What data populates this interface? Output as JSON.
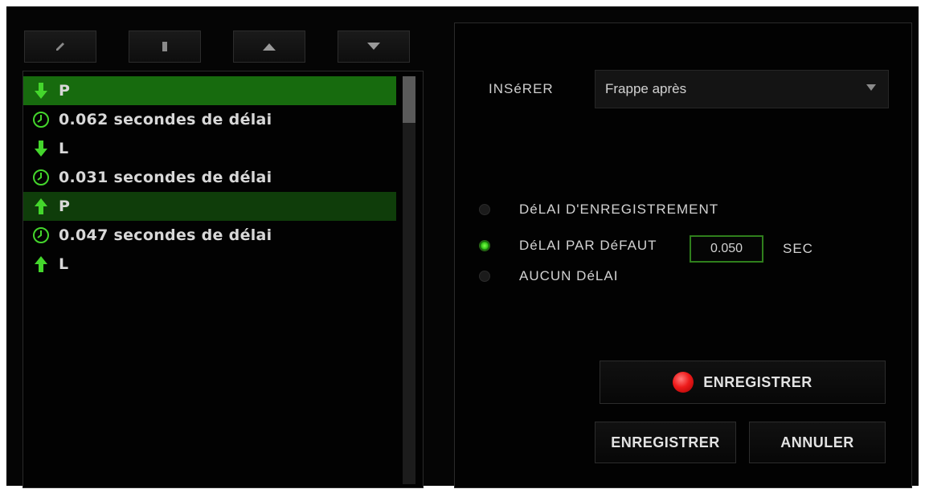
{
  "toolbar": {
    "buttons": [
      {
        "name": "edit-button",
        "icon": "pencil-icon"
      },
      {
        "name": "delete-button",
        "icon": "trash-icon"
      },
      {
        "name": "move-up-button",
        "icon": "triangle-up-icon"
      },
      {
        "name": "move-down-button",
        "icon": "triangle-down-icon"
      }
    ]
  },
  "macro_list": {
    "items": [
      {
        "type": "key-down",
        "label": "P",
        "selected": true
      },
      {
        "type": "delay",
        "label": "0.062 secondes de délai"
      },
      {
        "type": "key-down",
        "label": "L"
      },
      {
        "type": "delay",
        "label": "0.031 secondes de délai"
      },
      {
        "type": "key-up",
        "label": "P",
        "selected": true
      },
      {
        "type": "delay",
        "label": "0.047 secondes de délai"
      },
      {
        "type": "key-up",
        "label": "L"
      }
    ]
  },
  "insert": {
    "label": "INSéRER",
    "selected": "Frappe après"
  },
  "delay_options": {
    "record": "DéLAI D'ENREGISTREMENT",
    "default": "DéLAI PAR DéFAUT",
    "default_value": "0.050",
    "unit": "SEC",
    "none": "AUCUN DéLAI",
    "selected": "default"
  },
  "buttons": {
    "record": "ENREGISTRER",
    "save": "ENREGISTRER",
    "cancel": "ANNULER"
  },
  "colors": {
    "accent_green": "#44d62c",
    "record_red": "#ee1b1b"
  }
}
